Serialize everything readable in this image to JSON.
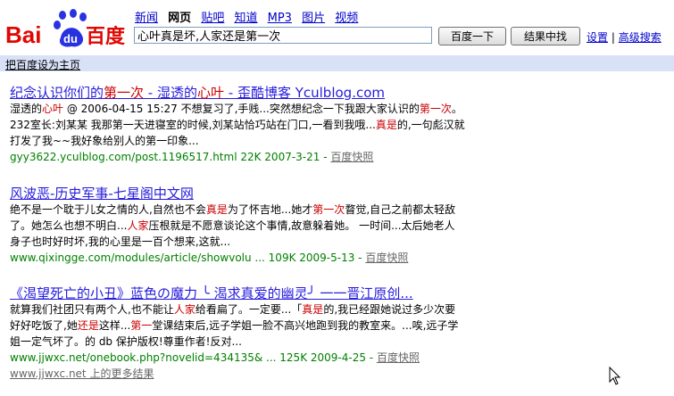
{
  "logo": {
    "text_bai": "Bai",
    "text_du": "du",
    "text_baidu_cn": "百度"
  },
  "nav": {
    "news": "新闻",
    "web": "网页",
    "tieba": "贴吧",
    "zhidao": "知道",
    "mp3": "MP3",
    "images": "图片",
    "video": "视频"
  },
  "search": {
    "query": "心叶真是坏,人家还是第一次",
    "button_search": "百度一下",
    "button_within": "结果中找"
  },
  "toplinks": {
    "settings": "设置",
    "advanced": "高级搜索",
    "sep": "|"
  },
  "homepage_link": "把百度设为主页",
  "results": [
    {
      "title_parts": [
        {
          "text": "纪念认识你们的",
          "hl": false
        },
        {
          "text": "第一次",
          "hl": true
        },
        {
          "text": " - 湿透的",
          "hl": false
        },
        {
          "text": "心叶",
          "hl": true
        },
        {
          "text": " - 歪酷博客 Yculblog.com",
          "hl": false
        }
      ],
      "desc_parts": [
        {
          "text": "湿透的",
          "hl": false
        },
        {
          "text": "心叶",
          "hl": true
        },
        {
          "text": " @ 2006-04-15 15:27 不想复习了,手贱...突然想纪念一下我跟大家认识的",
          "hl": false
        },
        {
          "text": "第一次",
          "hl": true
        },
        {
          "text": "。 232室长:刘某某 我那第一天进寝室的时候,刘某站恰巧站在门口,一看到我哦...",
          "hl": false
        },
        {
          "text": "真是",
          "hl": true
        },
        {
          "text": "的,一句彪汉就打发了我~~我好象给别人的第一印象...",
          "hl": false
        }
      ],
      "url": "gyy3622.yculblog.com/post.1196517.html 22K 2007-3-21 - ",
      "snapshot": "百度快照"
    },
    {
      "title_parts": [
        {
          "text": "风波恶-历史军事-七星阁中文网",
          "hl": false
        }
      ],
      "desc_parts": [
        {
          "text": "绝不是一个耽于儿女之情的人,自然也不会",
          "hl": false
        },
        {
          "text": "真是",
          "hl": true
        },
        {
          "text": "为了怀吉地...她才",
          "hl": false
        },
        {
          "text": "第一次",
          "hl": true
        },
        {
          "text": "瞀觉,自己之前都太轻敌了。她怎么也想不明白...",
          "hl": false
        },
        {
          "text": "人家",
          "hl": true
        },
        {
          "text": "压根就是不愿意谈论这个事情,故意躲着她。 一时间...太后她老人身子也时好时坏,我的心里是一百个想来,这就...",
          "hl": false
        }
      ],
      "url": "www.qixingge.com/modules/article/showvolu ... 109K 2009-5-13 - ",
      "snapshot": "百度快照"
    },
    {
      "title_parts": [
        {
          "text": "《渴望死亡的小丑》蓝色の魔力 ╰ 渴求真爱的幽灵╯ 一一晋江原创...",
          "hl": false
        }
      ],
      "desc_parts": [
        {
          "text": "就算我们社团只有两个人,也不能让",
          "hl": false
        },
        {
          "text": "人家",
          "hl": true
        },
        {
          "text": "给看扁了。一定要...「",
          "hl": false
        },
        {
          "text": "真是",
          "hl": true
        },
        {
          "text": "的,我已经跟她说过多少次要好好吃饭了,她",
          "hl": false
        },
        {
          "text": "还是",
          "hl": true
        },
        {
          "text": "这样...",
          "hl": false
        },
        {
          "text": "第一",
          "hl": true
        },
        {
          "text": "堂课结束后,远子学姐一脸不高兴地跑到我的教室来。...唉,远子学姐一定气坏了。的 db 保护版权!尊重作者!反对...",
          "hl": false
        }
      ],
      "url": "www.jjwxc.net/onebook.php?novelid=434135& ... 125K 2009-4-25 - ",
      "snapshot": "百度快照"
    }
  ],
  "more_results": "www.jjwxc.net 上的更多结果",
  "colors": {
    "link": "#261cdc",
    "highlight": "#cc0000",
    "url": "#008000",
    "bar": "#d9e1f7",
    "logo_red": "#e10602",
    "logo_blue": "#2932e1"
  }
}
